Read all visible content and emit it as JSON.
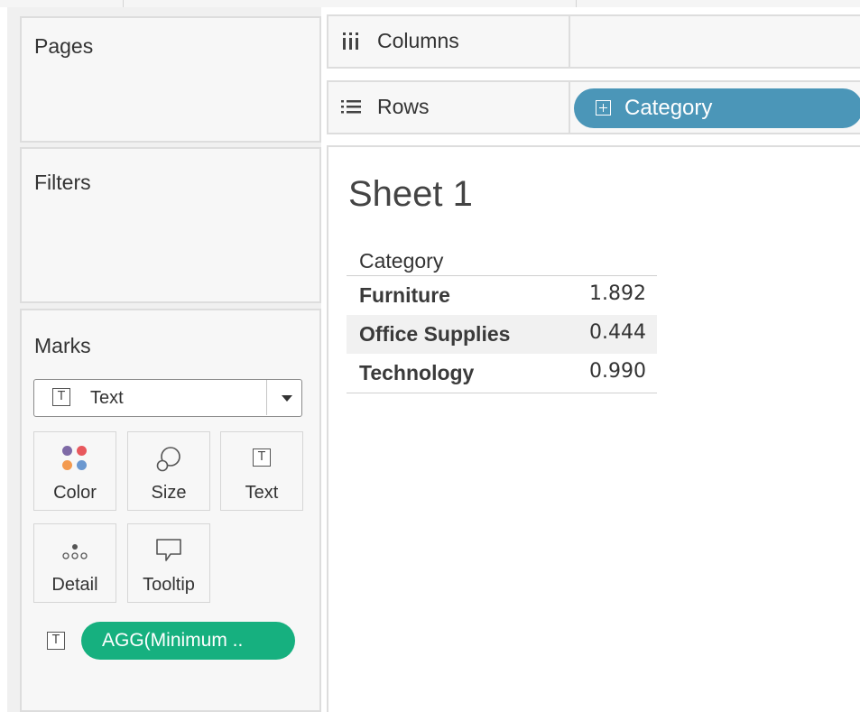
{
  "left_panel": {
    "pages_title": "Pages",
    "filters_title": "Filters",
    "marks": {
      "title": "Marks",
      "mark_type": "Text",
      "buttons": [
        {
          "label": "Color",
          "icon": "color-dots-icon"
        },
        {
          "label": "Size",
          "icon": "size-icon"
        },
        {
          "label": "Text",
          "icon": "text-icon"
        },
        {
          "label": "Detail",
          "icon": "detail-icon"
        },
        {
          "label": "Tooltip",
          "icon": "tooltip-icon"
        }
      ],
      "text_pill": "AGG(Minimum .."
    }
  },
  "shelves": {
    "columns_label": "Columns",
    "rows_label": "Rows",
    "rows_pill": "Category"
  },
  "view": {
    "sheet_title": "Sheet 1",
    "table": {
      "column_header": "Category",
      "rows": [
        {
          "category": "Furniture",
          "value": "1.892"
        },
        {
          "category": "Office Supplies",
          "value": "0.444"
        },
        {
          "category": "Technology",
          "value": "0.990"
        }
      ]
    }
  },
  "colors": {
    "rows_pill": "#4b96b8",
    "measure_pill": "#16b07f"
  }
}
